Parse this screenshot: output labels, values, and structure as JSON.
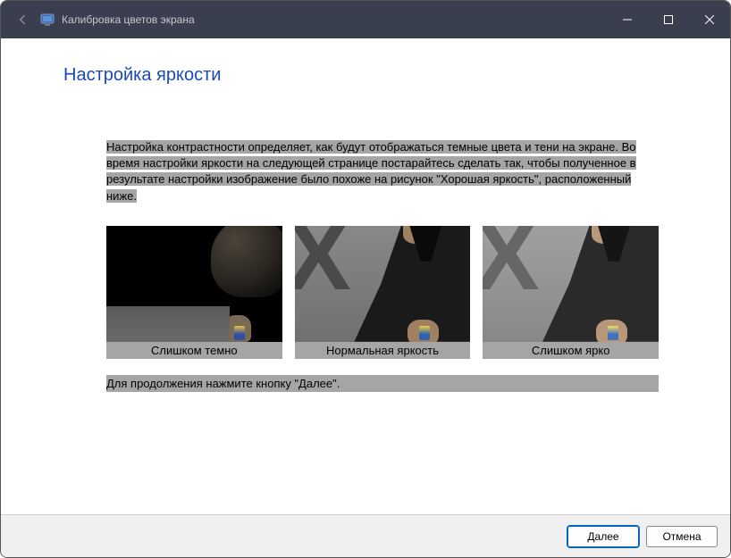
{
  "titlebar": {
    "title": "Калибровка цветов экрана"
  },
  "page": {
    "heading": "Настройка яркости",
    "description": "Настройка контрастности определяет, как будут отображаться темные цвета и тени на экране.\nВо время настройки яркости на следующей странице постарайтесь сделать так, чтобы полученное в результате настройки изображение было похоже на рисунок \"Хорошая яркость\", расположенный ниже.",
    "continue_hint": "Для продолжения нажмите кнопку \"Далее\"."
  },
  "samples": [
    {
      "caption": "Слишком темно"
    },
    {
      "caption": "Нормальная яркость"
    },
    {
      "caption": "Слишком ярко"
    }
  ],
  "footer": {
    "next_label": "Далее",
    "cancel_label": "Отмена"
  }
}
